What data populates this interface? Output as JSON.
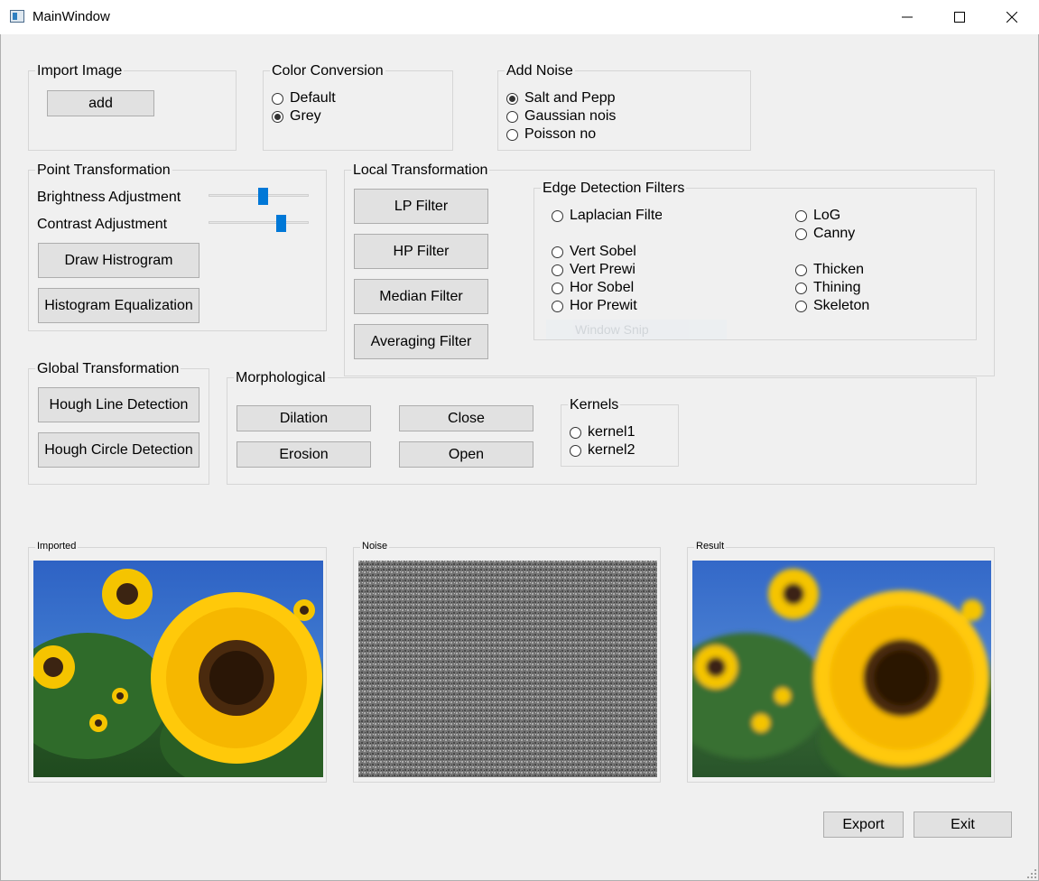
{
  "window": {
    "title": "MainWindow",
    "minimize_icon": "minimize-icon",
    "maximize_icon": "maximize-icon",
    "close_icon": "close-icon"
  },
  "import_image": {
    "title": "Import Image",
    "add_label": "add"
  },
  "color_conversion": {
    "title": "Color Conversion",
    "options": [
      "Default",
      "Grey"
    ],
    "selected": "Grey"
  },
  "add_noise": {
    "title": "Add Noise",
    "options": [
      "Salt and Pepp",
      "Gaussian nois",
      "Poisson no"
    ],
    "selected": "Salt and Pepp"
  },
  "point_transformation": {
    "title": "Point Transformation",
    "brightness_label": "Brightness Adjustment",
    "contrast_label": "Contrast Adjustment",
    "brightness_value": 0.55,
    "contrast_value": 0.75,
    "draw_histogram_label": "Draw Histrogram",
    "histogram_equalization_label": "Histogram Equalization"
  },
  "local_transformation": {
    "title": "Local Transformation",
    "buttons": [
      "LP Filter",
      "HP Filter",
      "Median Filter",
      "Averaging Filter"
    ]
  },
  "edge_detection": {
    "title": "Edge Detection Filters",
    "left_options": [
      "Laplacian Filte",
      "Vert Sobel",
      "Vert Prewi",
      "Hor Sobel",
      "Hor Prewit"
    ],
    "right_options": [
      "LoG",
      "Canny",
      "Thicken",
      "Thining",
      "Skeleton"
    ],
    "ghost_text": "Window Snip"
  },
  "global_transformation": {
    "title": "Global Transformation",
    "hough_line_label": "Hough Line Detection",
    "hough_circle_label": "Hough Circle Detection"
  },
  "morphological": {
    "title": "Morphological",
    "dilation_label": "Dilation",
    "close_label": "Close",
    "erosion_label": "Erosion",
    "open_label": "Open",
    "kernels_title": "Kernels",
    "kernels": [
      "kernel1",
      "kernel2"
    ]
  },
  "panels": {
    "imported": "Imported",
    "noise": "Noise",
    "result": "Result"
  },
  "footer": {
    "export_label": "Export",
    "exit_label": "Exit"
  }
}
